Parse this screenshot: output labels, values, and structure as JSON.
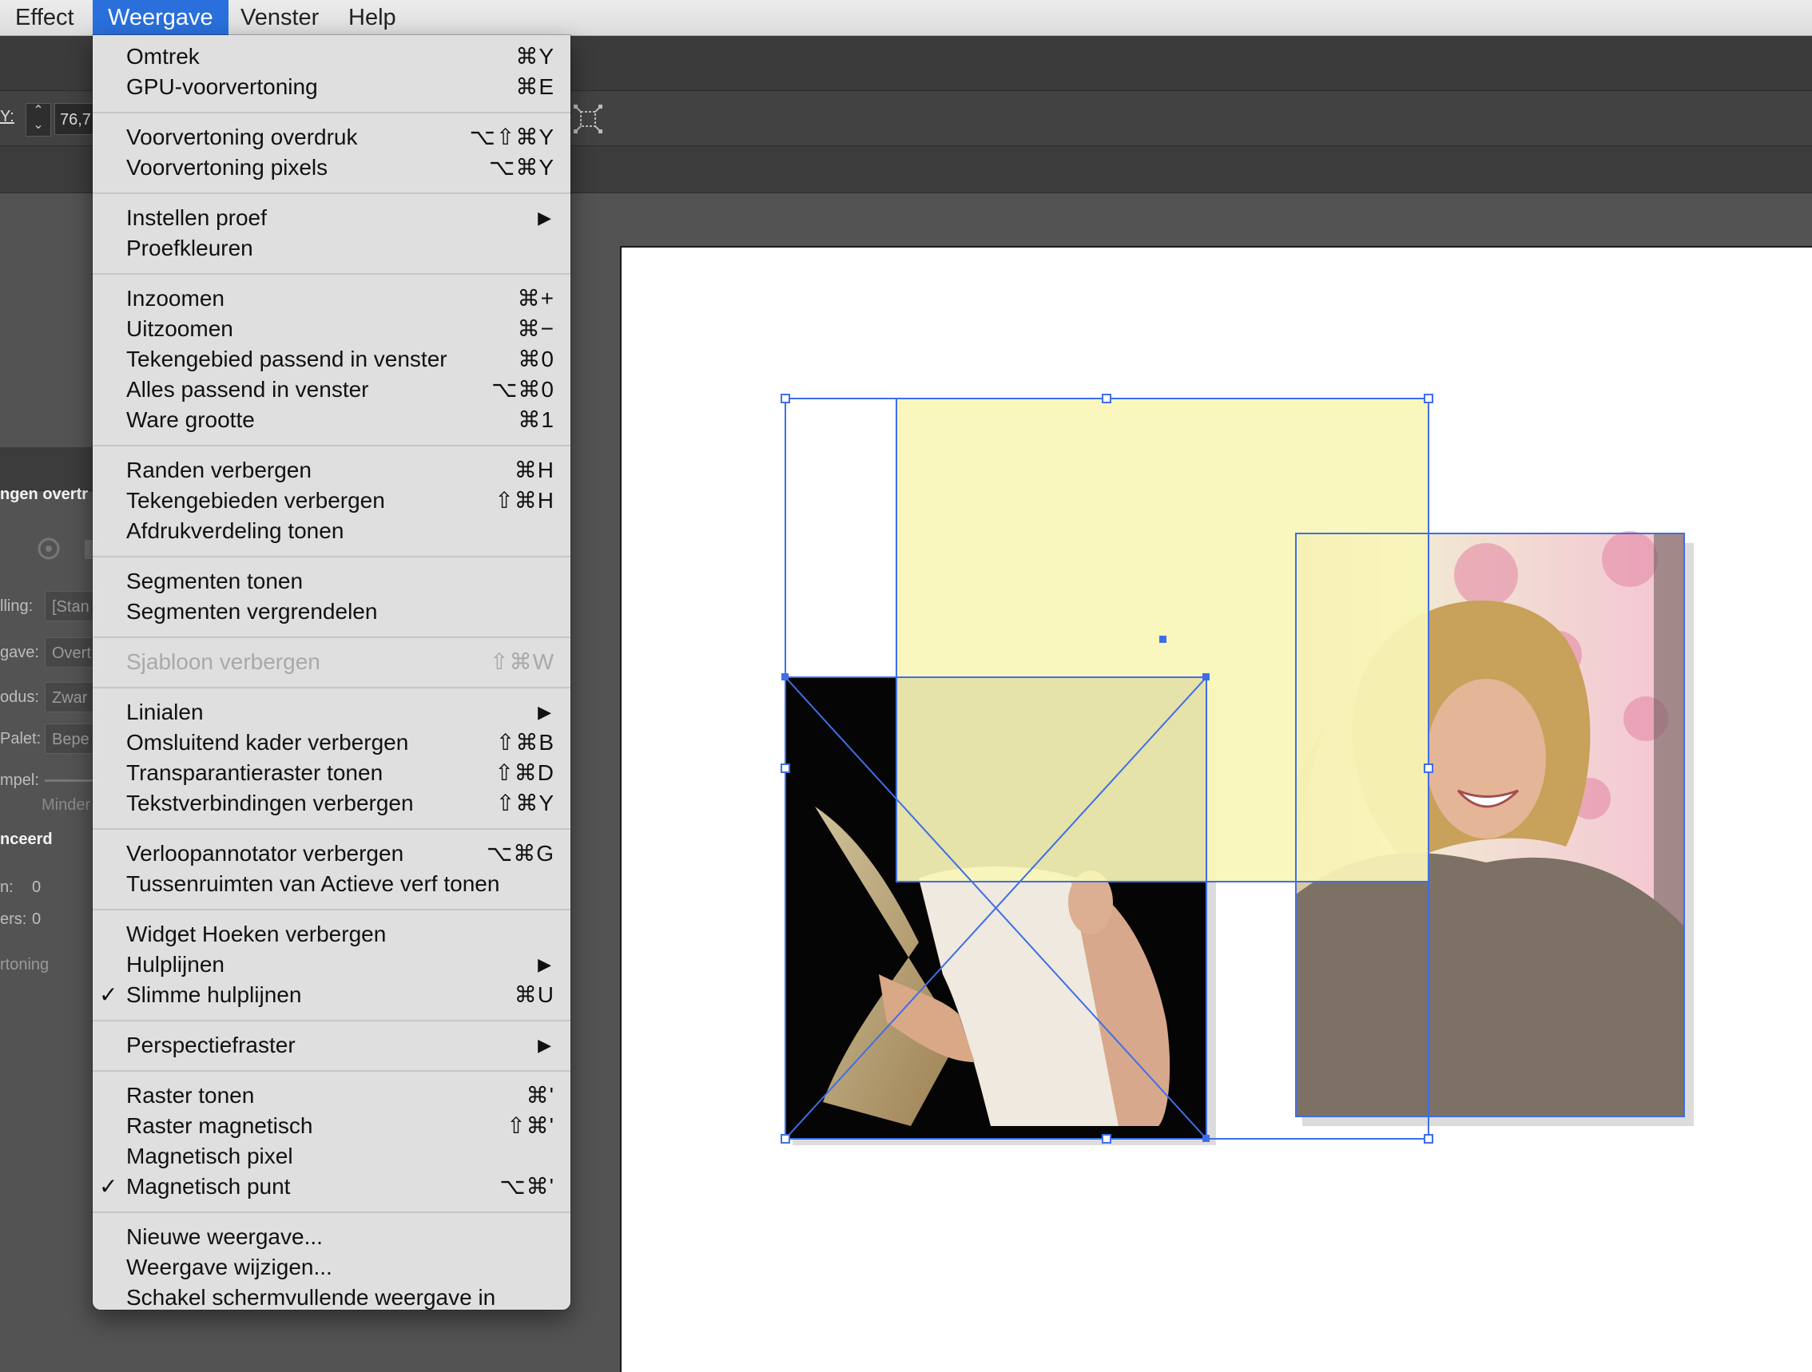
{
  "menubar": {
    "items": [
      {
        "label": "Effect",
        "active": false
      },
      {
        "label": "Weergave",
        "active": true
      },
      {
        "label": "Venster",
        "active": false
      },
      {
        "label": "Help",
        "active": false
      }
    ]
  },
  "control_bar": {
    "y_label": "Y:",
    "y_value": "76,7"
  },
  "left_panel": {
    "header": "ngen overtr",
    "labels": {
      "instelling": "lling:",
      "instelling_value": "[Stan",
      "weergave": "gave:",
      "weergave_value": "Overt",
      "modus": "odus:",
      "modus_value": "Zwar",
      "palet": "Palet:",
      "palet_value": "Bepe",
      "drempel": "mpel:",
      "minder": "Minder",
      "geavanceerd": "nceerd",
      "n_label": "n:",
      "n_value": "0",
      "ers_label": "ers:",
      "ers_value": "0",
      "voorvertoning": "rtoning"
    }
  },
  "dropdown": {
    "groups": [
      [
        {
          "label": "Omtrek",
          "shortcut": "⌘Y"
        },
        {
          "label": "GPU-voorvertoning",
          "shortcut": "⌘E"
        }
      ],
      [
        {
          "label": "Voorvertoning overdruk",
          "shortcut": "⌥⇧⌘Y"
        },
        {
          "label": "Voorvertoning pixels",
          "shortcut": "⌥⌘Y"
        }
      ],
      [
        {
          "label": "Instellen proef",
          "submenu": true
        },
        {
          "label": "Proefkleuren"
        }
      ],
      [
        {
          "label": "Inzoomen",
          "shortcut": "⌘+"
        },
        {
          "label": "Uitzoomen",
          "shortcut": "⌘−"
        },
        {
          "label": "Tekengebied passend in venster",
          "shortcut": "⌘0"
        },
        {
          "label": "Alles passend in venster",
          "shortcut": "⌥⌘0"
        },
        {
          "label": "Ware grootte",
          "shortcut": "⌘1"
        }
      ],
      [
        {
          "label": "Randen verbergen",
          "shortcut": "⌘H"
        },
        {
          "label": "Tekengebieden verbergen",
          "shortcut": "⇧⌘H"
        },
        {
          "label": "Afdrukverdeling tonen"
        }
      ],
      [
        {
          "label": "Segmenten tonen"
        },
        {
          "label": "Segmenten vergrendelen"
        }
      ],
      [
        {
          "label": "Sjabloon verbergen",
          "shortcut": "⇧⌘W",
          "disabled": true
        }
      ],
      [
        {
          "label": "Linialen",
          "submenu": true
        },
        {
          "label": "Omsluitend kader verbergen",
          "shortcut": "⇧⌘B"
        },
        {
          "label": "Transparantieraster tonen",
          "shortcut": "⇧⌘D"
        },
        {
          "label": "Tekstverbindingen verbergen",
          "shortcut": "⇧⌘Y"
        }
      ],
      [
        {
          "label": "Verloopannotator verbergen",
          "shortcut": "⌥⌘G"
        },
        {
          "label": "Tussenruimten van Actieve verf tonen"
        }
      ],
      [
        {
          "label": "Widget Hoeken verbergen"
        },
        {
          "label": "Hulplijnen",
          "submenu": true
        },
        {
          "label": "Slimme hulplijnen",
          "shortcut": "⌘U",
          "checked": true
        }
      ],
      [
        {
          "label": "Perspectiefraster",
          "submenu": true
        }
      ],
      [
        {
          "label": "Raster tonen",
          "shortcut": "⌘'"
        },
        {
          "label": "Raster magnetisch",
          "shortcut": "⇧⌘'"
        },
        {
          "label": "Magnetisch pixel"
        },
        {
          "label": "Magnetisch punt",
          "shortcut": "⌥⌘'",
          "checked": true
        }
      ],
      [
        {
          "label": "Nieuwe weergave..."
        },
        {
          "label": "Weergave wijzigen..."
        },
        {
          "label": "Schakel schermvullende weergave in"
        }
      ]
    ],
    "checkmark": "✓",
    "submenu_arrow": "▶"
  },
  "colors": {
    "menubar_active": "#2a6fdc",
    "selection": "#3e6ee8",
    "yellow_fill": "#f9f5b8"
  }
}
